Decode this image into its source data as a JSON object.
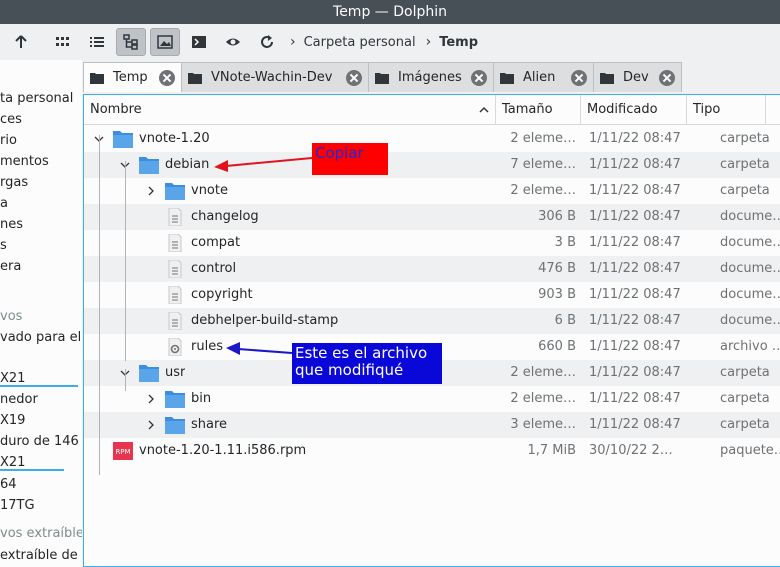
{
  "window": {
    "title": "Temp — Dolphin"
  },
  "toolbar": {
    "buttons": [
      "go-up-icon",
      "icons-view-icon",
      "details-view-icon",
      "tree-view-icon",
      "preview-icon",
      "terminal-icon",
      "show-hidden-icon",
      "reload-icon"
    ]
  },
  "breadcrumb": {
    "items": [
      "Carpeta personal",
      "Temp"
    ]
  },
  "sidebar": {
    "items": [
      {
        "label": "ta personal",
        "type": "item"
      },
      {
        "label": "ces",
        "type": "item"
      },
      {
        "label": "rio",
        "type": "item"
      },
      {
        "label": "mentos",
        "type": "item"
      },
      {
        "label": "rgas",
        "type": "item"
      },
      {
        "label": "a",
        "type": "item"
      },
      {
        "label": "nes",
        "type": "item"
      },
      {
        "label": "s",
        "type": "item"
      },
      {
        "label": "era",
        "type": "item"
      },
      {
        "label": "vos",
        "type": "section"
      },
      {
        "label": "vado para el",
        "type": "item"
      },
      {
        "label": "X21",
        "type": "item"
      },
      {
        "label": "nedor",
        "type": "item"
      },
      {
        "label": "X19",
        "type": "item"
      },
      {
        "label": "duro de 146",
        "type": "item"
      },
      {
        "label": "X21",
        "type": "item"
      },
      {
        "label": "64",
        "type": "item"
      },
      {
        "label": "17TG",
        "type": "item"
      },
      {
        "label": "vos extraíble",
        "type": "section"
      },
      {
        "label": "extraíble de",
        "type": "item"
      }
    ]
  },
  "tabs": [
    {
      "label": "Temp",
      "active": true
    },
    {
      "label": "VNote-Wachin-Dev",
      "active": false
    },
    {
      "label": "Imágenes",
      "active": false
    },
    {
      "label": "Alien",
      "active": false
    },
    {
      "label": "Dev",
      "active": false
    }
  ],
  "columns": {
    "name": "Nombre",
    "size": "Tamaño",
    "modified": "Modificado",
    "type": "Tipo"
  },
  "files": [
    {
      "name": "vnote-1.20",
      "size": "2 eleme…",
      "modified": "1/11/22 08:47",
      "type": "carpeta",
      "depth": 0,
      "kind": "folder",
      "expanded": true
    },
    {
      "name": "debian",
      "size": "7 eleme…",
      "modified": "1/11/22 08:47",
      "type": "carpeta",
      "depth": 1,
      "kind": "folder",
      "expanded": true
    },
    {
      "name": "vnote",
      "size": "2 eleme…",
      "modified": "1/11/22 08:47",
      "type": "carpeta",
      "depth": 2,
      "kind": "folder",
      "expanded": false
    },
    {
      "name": "changelog",
      "size": "306 B",
      "modified": "1/11/22 08:47",
      "type": "docume…",
      "depth": 2,
      "kind": "doc"
    },
    {
      "name": "compat",
      "size": "3 B",
      "modified": "1/11/22 08:47",
      "type": "docume…",
      "depth": 2,
      "kind": "doc"
    },
    {
      "name": "control",
      "size": "476 B",
      "modified": "1/11/22 08:47",
      "type": "docume…",
      "depth": 2,
      "kind": "doc"
    },
    {
      "name": "copyright",
      "size": "903 B",
      "modified": "1/11/22 08:47",
      "type": "docume…",
      "depth": 2,
      "kind": "doc"
    },
    {
      "name": "debhelper-build-stamp",
      "size": "6 B",
      "modified": "1/11/22 08:47",
      "type": "docume…",
      "depth": 2,
      "kind": "doc"
    },
    {
      "name": "rules",
      "size": "660 B",
      "modified": "1/11/22 08:47",
      "type": "archivo …",
      "depth": 2,
      "kind": "script"
    },
    {
      "name": "usr",
      "size": "2 eleme…",
      "modified": "1/11/22 08:47",
      "type": "carpeta",
      "depth": 1,
      "kind": "folder",
      "expanded": true
    },
    {
      "name": "bin",
      "size": "2 eleme…",
      "modified": "1/11/22 08:47",
      "type": "carpeta",
      "depth": 2,
      "kind": "folder",
      "expanded": false
    },
    {
      "name": "share",
      "size": "3 eleme…",
      "modified": "1/11/22 08:47",
      "type": "carpeta",
      "depth": 2,
      "kind": "folder",
      "expanded": false
    },
    {
      "name": "vnote-1.20-1.11.i586.rpm",
      "size": "1,7 MiB",
      "modified": "30/10/22 2…",
      "type": "paquete…",
      "depth": 0,
      "kind": "rpm"
    }
  ],
  "annotations": {
    "copy": "Copiar",
    "modified_line1": "Este es el archivo",
    "modified_line2": "que modifiqué"
  },
  "colors": {
    "accent": "#3daee9",
    "folder": "#3d8ee0",
    "annotation_red": "#ff0000",
    "annotation_blue": "#0a08d8",
    "arrow_red": "#e0141e",
    "arrow_blue": "#1d16c9"
  }
}
